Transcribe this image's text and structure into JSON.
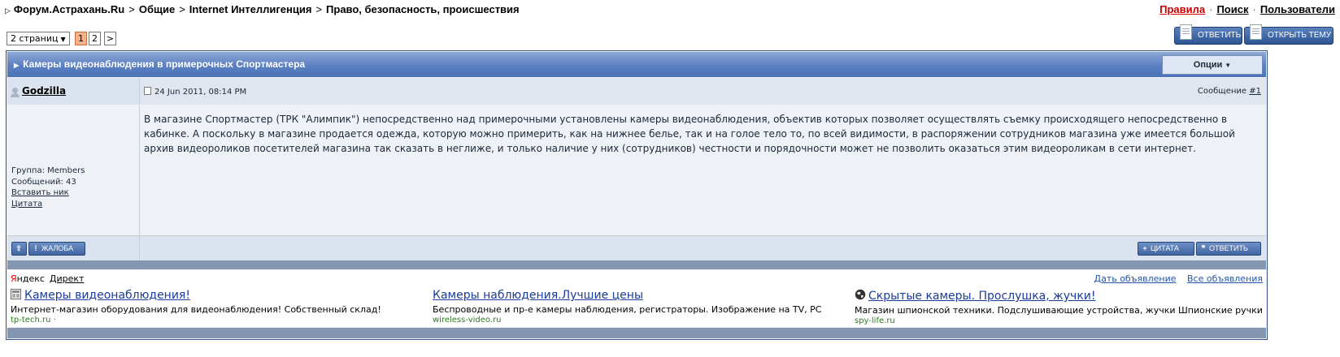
{
  "breadcrumb": {
    "items": [
      "Форум.Астрахань.Ru",
      "Общие",
      "Internet Интеллигенция",
      "Право, безопасность, происшествия"
    ],
    "separator": ">"
  },
  "top_links": {
    "rules": "Правила",
    "search": "Поиск",
    "users": "Пользователи",
    "dot": "·"
  },
  "pagination": {
    "pages_label": "2 страниц",
    "pages": [
      "1",
      "2"
    ],
    "current": "1",
    "next": ">"
  },
  "actions": {
    "reply": "ОТВЕТИТЬ",
    "new_topic": "ОТКРЫТЬ ТЕМУ"
  },
  "topic": {
    "title": "Камеры видеонаблюдения в примерочных Спортмастера",
    "options": "Опции"
  },
  "post": {
    "author": "Godzilla",
    "date": "24 Jun 2011, 08:14 PM",
    "number_label": "Сообщение",
    "number": "#1",
    "group": "Группа: Members",
    "messages": "Сообщений: 43",
    "insert_nick": "Вставить ник",
    "quote_link": "Цитата",
    "body": "В магазине Спортмастер (ТРК \"Алимпик\") непосредственно над примерочными установлены камеры видеонаблюдения, объектив которых позволяет осуществлять съемку происходящего непосредственно в кабинке. А поскольку в магазине продается одежда, которую можно примерить, как на нижнее белье, так и на голое тело то, по всей видимости, в распоряжении сотрудников магазина уже имеется большой архив видеороликов посетителей магазина так сказать в неглиже, и только наличие у них (сотрудников) честности и порядочности может не позволить оказаться этим видеороликам в сети интернет.",
    "buttons": {
      "report": "ЖАЛОБА",
      "quote": "ЦИТАТА",
      "reply": "ОТВЕТИТЬ"
    }
  },
  "ads": {
    "brand_y": "Я",
    "brand_rest": "ндекс",
    "direct": "Директ",
    "give_ad": "Дать объявление",
    "all_ads": "Все объявления",
    "items": [
      {
        "title": "Камеры видеонаблюдения!",
        "desc": "Интернет-магазин оборудования для видеонаблюдения! Собственный склад!",
        "url": "tp-tech.ru",
        "icon": "store-icon"
      },
      {
        "title": "Камеры наблюдения.Лучшие цены",
        "desc": "Беспроводные и пр-е камеры наблюдения, регистраторы. Изображение на TV, PC",
        "url": "wireless-video.ru",
        "icon": ""
      },
      {
        "title": "Скрытые камеры. Прослушка, жучки!",
        "desc": "Магазин шпионской техники. Подслушивающие устройства, жучки Шпионские ручки",
        "url": "spy-life.ru",
        "icon": "globe-icon"
      }
    ]
  },
  "colors": {
    "header_blue": "#5b7fc1",
    "button_blue": "#2e5592",
    "rules_red": "#cc0000",
    "ad_link": "#1a3c9a",
    "ad_url": "#2e7a24"
  }
}
